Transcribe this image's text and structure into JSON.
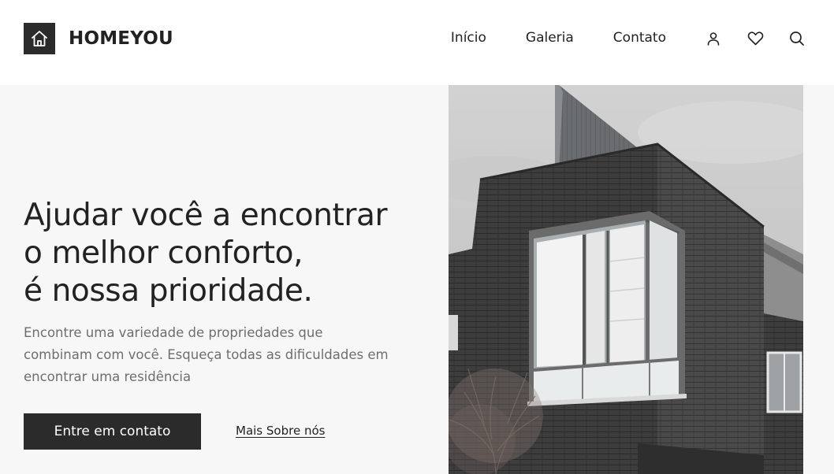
{
  "brand": {
    "name": "HOMEYOU",
    "icon": "house-icon"
  },
  "nav": {
    "items": [
      {
        "label": "Início"
      },
      {
        "label": "Galeria"
      },
      {
        "label": "Contato"
      }
    ]
  },
  "header_icons": [
    {
      "icon": "user-icon"
    },
    {
      "icon": "heart-icon"
    },
    {
      "icon": "search-icon"
    }
  ],
  "hero": {
    "title_lines": [
      "Ajudar você a encontrar",
      "o melhor conforto,",
      "é nossa prioridade."
    ],
    "description_lines": [
      "Encontre uma variedade de propriedades que",
      "combinam com você. Esqueça todas as dificuldades em",
      "encontrar uma residência"
    ],
    "cta_label": "Entre em contato",
    "more_label": "Mais Sobre nós"
  },
  "colors": {
    "dark": "#2b2b2b",
    "hero_background": "#f7f7f7",
    "muted_text": "#6e6e6e"
  }
}
